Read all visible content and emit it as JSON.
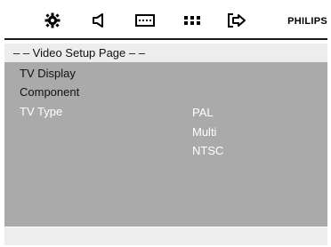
{
  "toolbar": {
    "icons": [
      "gear-icon",
      "speaker-icon",
      "display-icon",
      "dots-grid-icon",
      "exit-arrow-icon"
    ],
    "brand": "PHILIPS"
  },
  "page": {
    "title": "– –  Video Setup Page  – –"
  },
  "menu": {
    "items": [
      {
        "label": "TV Display",
        "selected": false
      },
      {
        "label": "Component",
        "selected": false
      },
      {
        "label": "TV Type",
        "selected": true
      }
    ],
    "options": [
      "PAL",
      "Multi",
      "NTSC"
    ]
  },
  "colors": {
    "panel_bg": "#aaaaaa",
    "header_bg": "#ededed",
    "selected_text": "#ffffff"
  }
}
